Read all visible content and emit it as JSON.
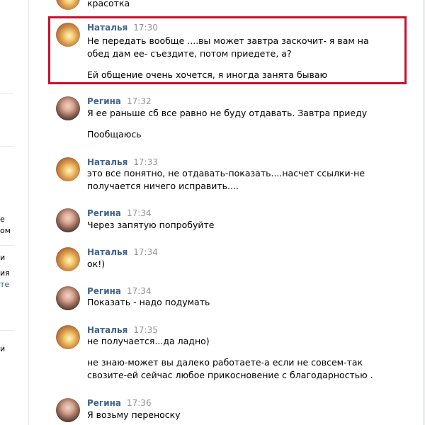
{
  "left_fragments": [
    {
      "text": "е",
      "link": false
    },
    {
      "text": "ом",
      "link": false
    },
    {
      "text": "и",
      "link": false
    },
    {
      "text": "ия",
      "link": false
    },
    {
      "text": "те",
      "link": true
    },
    {
      "text": "и",
      "link": false
    }
  ],
  "top_partial_message": {
    "text": "красотка"
  },
  "messages": [
    {
      "author": "Наталья",
      "time": "17:30",
      "avatar": "natalia",
      "lines": [
        "Не передать вообще ....вы может завтра заскочит- я вам на",
        "обед дам ее- съездите, потом приедете, а?",
        "",
        "Ей общение очень хочется, я иногда занята бываю"
      ]
    },
    {
      "author": "Регина",
      "time": "17:32",
      "avatar": "regina",
      "lines": [
        "Я ее раньше сб все равно не буду отдавать. Завтра приеду",
        "",
        "Пообщаюсь"
      ]
    },
    {
      "author": "Наталья",
      "time": "17:33",
      "avatar": "natalia",
      "lines": [
        "это все понятно, не отдавать-показать....насчет ссылки-не",
        "получается ничего исправить...."
      ]
    },
    {
      "author": "Регина",
      "time": "17:34",
      "avatar": "regina",
      "lines": [
        "Через запятую попробуйте"
      ]
    },
    {
      "author": "Наталья",
      "time": "17:34",
      "avatar": "natalia",
      "lines": [
        "ок!)"
      ]
    },
    {
      "author": "Регина",
      "time": "17:34",
      "avatar": "regina",
      "lines": [
        "Показать - надо подумать"
      ]
    },
    {
      "author": "Наталья",
      "time": "17:35",
      "avatar": "natalia",
      "lines": [
        "не получается...да ладно)",
        "",
        "не знаю-может вы далеко работаете-а если не совсем-так",
        "свозите-ей сейчас любое прикосновение с благодарностью ."
      ]
    },
    {
      "author": "Регина",
      "time": "17:36",
      "avatar": "regina",
      "lines": [
        "Я возьму переноску"
      ]
    }
  ]
}
